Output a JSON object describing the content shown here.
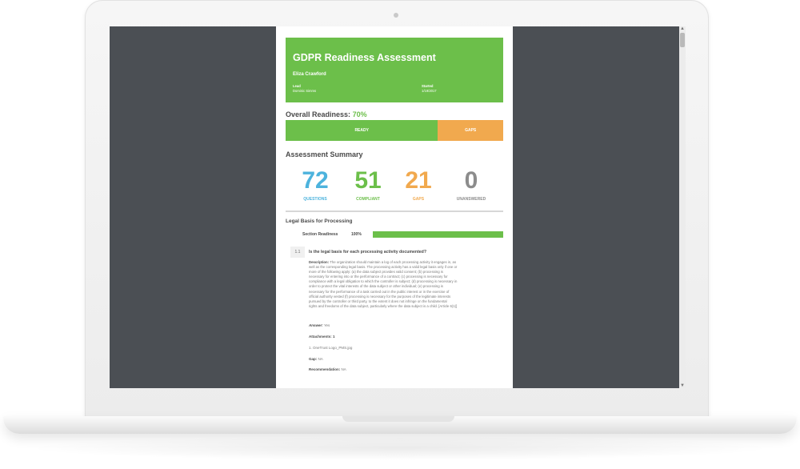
{
  "colors": {
    "green": "#6cbf4a",
    "orange": "#f1a94e",
    "blue": "#4db3dd",
    "gray": "#8c8c8c",
    "screen_bg": "#4b4f54"
  },
  "header": {
    "title": "GDPR Readiness Assessment",
    "respondent": "Eliza Crawford",
    "lead_label": "Lead",
    "lead_value": "Dominic Simms",
    "started_label": "Started",
    "started_value": "1/19/2017"
  },
  "overall": {
    "label": "Overall Readiness:",
    "percent_text": "70%",
    "ready_fraction": 0.7,
    "ready_label": "READY",
    "gaps_label": "GAPS"
  },
  "summary": {
    "title": "Assessment Summary",
    "stats": [
      {
        "value": "72",
        "label": "QUESTIONS",
        "color": "#4db3dd"
      },
      {
        "value": "51",
        "label": "COMPLIANT",
        "color": "#6cbf4a"
      },
      {
        "value": "21",
        "label": "GAPS",
        "color": "#f1a94e"
      },
      {
        "value": "0",
        "label": "UNANSWERED",
        "color": "#8c8c8c"
      }
    ]
  },
  "section": {
    "title": "Legal Basis for Processing",
    "readiness_label": "Section Readiness",
    "readiness_text": "100%",
    "readiness_fraction": 1.0
  },
  "question": {
    "number": "1.1",
    "title": "Is the legal basis for each processing activity documented?",
    "description_label": "Description:",
    "description_lines": [
      "The organization should maintain a log of each processing activity it engages in, as",
      "well as the corresponding legal basis. The processing activity has a valid legal basis only if one or",
      "more of the following apply: (a) the data subject provides valid consent; (b) processing is",
      "necessary for entering into or the performance of a contract; (c) processing is necessary for",
      "compliance with a legal obligation to which the controller is subject; (d) processing is necessary in",
      "order to protect the vital interests of the data subject or other individual; (e) processing is",
      "necessary for the performance of a task carried out in the public interest or in the exercise of",
      "official authority vested (f) processing is necessary for the purposes of the legitimate interests",
      "pursued by the controller or third party, to the extent it does not infringe on the fundamental",
      "rights and freedoms of the data subject, particularly where the data subject is a child. [Article 6(1)]"
    ],
    "answer_label": "Answer:",
    "answer_value": "Yes",
    "attachments_label": "Attachments: 1",
    "attachment_item": "1. OneTrust Logo_PMS.jpg",
    "gap_label": "Gap:",
    "gap_value": "NA",
    "recommendation_label": "Recommendation:",
    "recommendation_value": "NA"
  }
}
